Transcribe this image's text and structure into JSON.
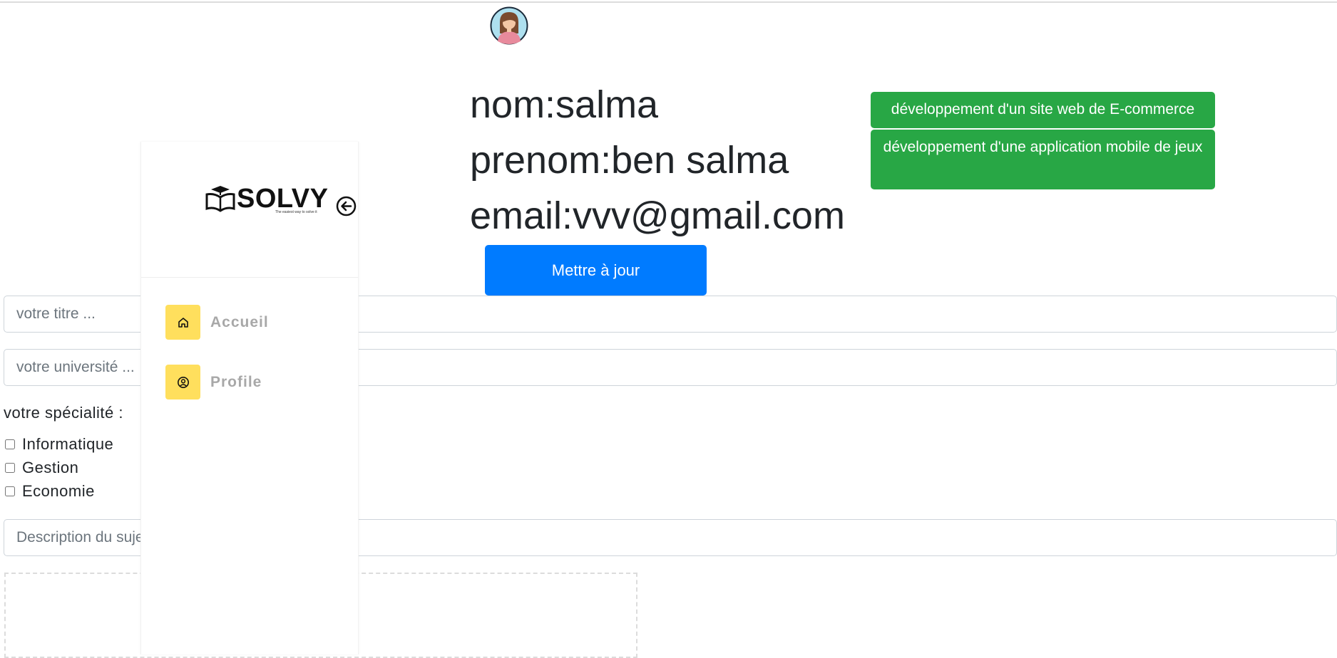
{
  "profile": {
    "nom": "nom:salma",
    "prenom": "prenom:ben salma",
    "email": "email:vvv@gmail.com",
    "update_label": "Mettre à jour"
  },
  "projects": [
    "développement d'un site web de E-commerce",
    "développement d'une application mobile de jeux"
  ],
  "form": {
    "title_placeholder": "votre titre ...",
    "university_placeholder": "votre université ...",
    "specialty_label": "votre spécialité :",
    "specialties": [
      "Informatique",
      "Gestion",
      "Economie"
    ],
    "description_placeholder": "Description du sujet"
  },
  "sidebar": {
    "logo_text": "SOLVY",
    "logo_tagline": "The easiest way to solve it",
    "items": [
      {
        "label": "Accueil",
        "icon": "home-icon"
      },
      {
        "label": "Profile",
        "icon": "user-circle-icon"
      }
    ]
  },
  "colors": {
    "primary": "#007bff",
    "success": "#28a745",
    "nav_icon_bg": "#ffdf5d",
    "nav_label": "#a8a8a8"
  }
}
